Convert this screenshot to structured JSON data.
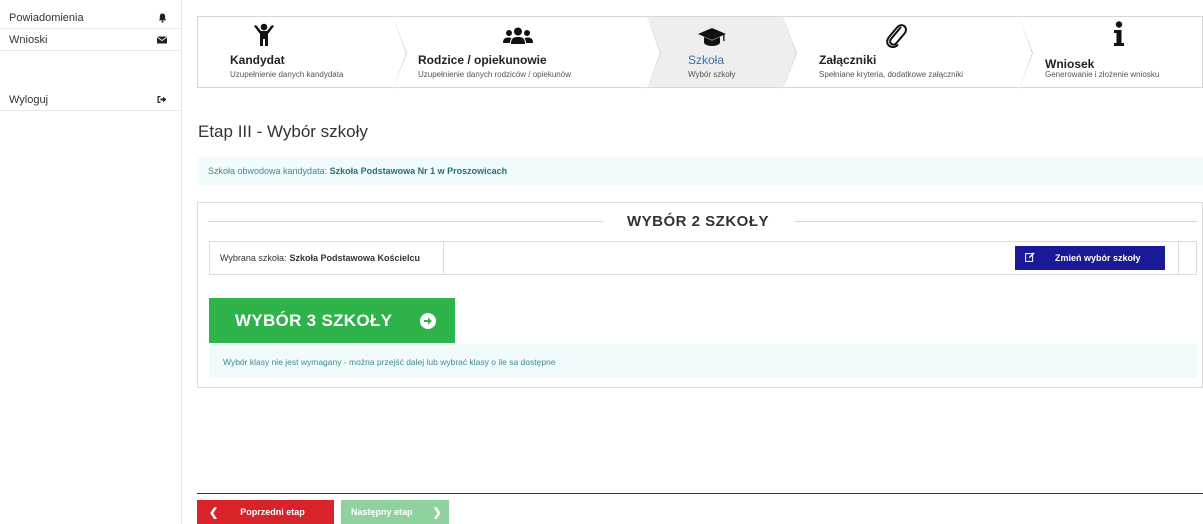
{
  "sidebar": {
    "items": [
      {
        "label": "Powiadomienia",
        "icon": "bell-icon"
      },
      {
        "label": "Wnioski",
        "icon": "envelope-icon"
      },
      {
        "label": "Wyloguj",
        "icon": "sign-out-icon"
      }
    ]
  },
  "steps": [
    {
      "title": "Kandydat",
      "sub": "Uzupełnienie danych kandydata",
      "icon": "child-icon"
    },
    {
      "title": "Rodzice / opiekunowie",
      "sub": "Uzupełnienie danych rodziców / opiekunów",
      "icon": "users-icon"
    },
    {
      "title": "Szkoła",
      "sub": "Wybór szkoły",
      "icon": "graduation-cap-icon",
      "active": true
    },
    {
      "title": "Załączniki",
      "sub": "Spełniane kryteria, dodatkowe załączniki",
      "icon": "paperclip-icon"
    },
    {
      "title": "Wniosek",
      "sub": "Generowanie i złożenie wniosku",
      "icon": "info-icon"
    }
  ],
  "page": {
    "title": "Etap III - Wybór szkoły",
    "district_label": "Szkoła obwodowa kandydata:",
    "district_school": "Szkoła Podstawowa Nr 1 w Proszowicach"
  },
  "panel": {
    "heading": "WYBÓR 2 SZKOŁY",
    "selected_label": "Wybrana szkoła:",
    "selected_school": "Szkoła Podstawowa Kościelcu",
    "change_button": "Zmień wybór szkoły",
    "choice3_button": "WYBÓR 3 SZKOŁY",
    "note": "Wybór klasy nie jest wymagany - można przejść dalej lub wybrać klasy o ile sa dostępne"
  },
  "footer": {
    "prev_label": "Poprzedni etap",
    "next_label": "Następny etap"
  },
  "colors": {
    "accent_blue": "#1a1a96",
    "green": "#2db34a",
    "red": "#d9232a",
    "disabled_green": "#8fd2a0",
    "info_bg": "#f2fbfc"
  }
}
